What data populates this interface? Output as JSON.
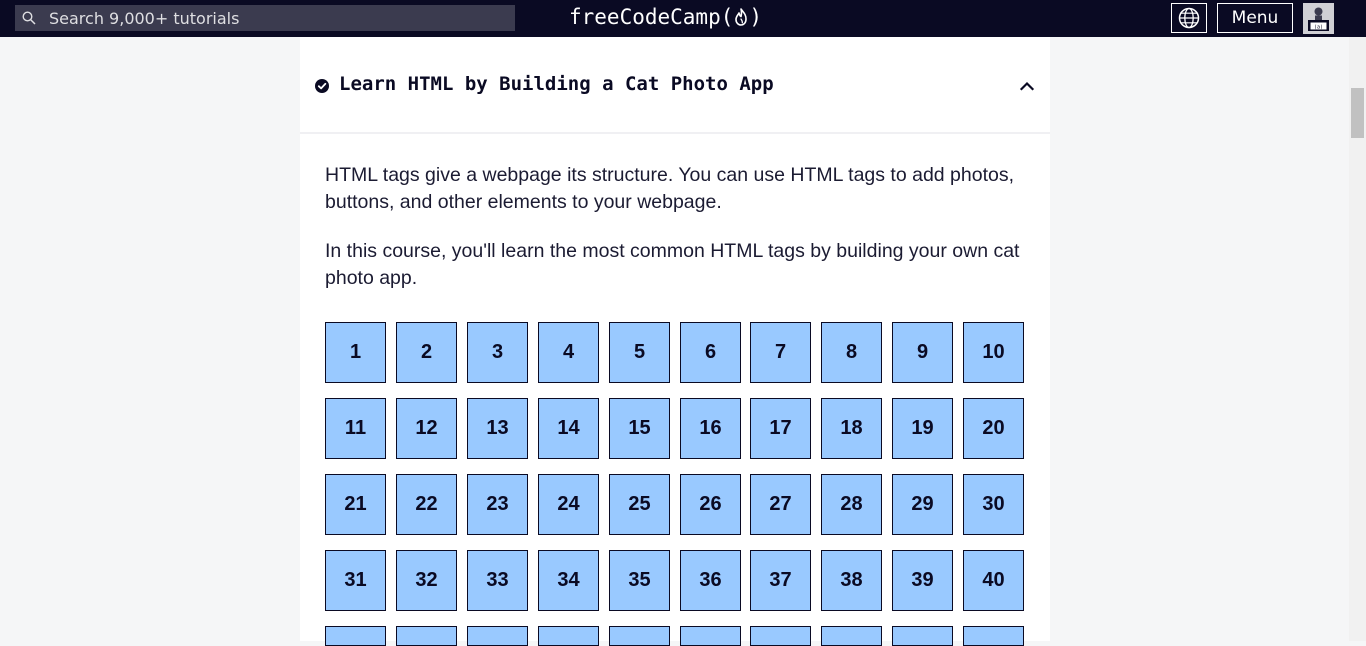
{
  "navbar": {
    "search_placeholder": "Search 9,000+ tutorials",
    "logo_prefix": "freeCodeCamp(",
    "logo_suffix": ")",
    "menu_label": "Menu",
    "background": "#0a0a23"
  },
  "block": {
    "title": "Learn HTML by Building a Cat Photo App",
    "completed": true,
    "expanded": true,
    "description": [
      "HTML tags give a webpage its structure. You can use HTML tags to add photos, buttons, and other elements to your webpage.",
      "In this course, you'll learn the most common HTML tags by building your own cat photo app."
    ],
    "step_color": "#99c9ff",
    "steps": [
      "1",
      "2",
      "3",
      "4",
      "5",
      "6",
      "7",
      "8",
      "9",
      "10",
      "11",
      "12",
      "13",
      "14",
      "15",
      "16",
      "17",
      "18",
      "19",
      "20",
      "21",
      "22",
      "23",
      "24",
      "25",
      "26",
      "27",
      "28",
      "29",
      "30",
      "31",
      "32",
      "33",
      "34",
      "35",
      "36",
      "37",
      "38",
      "39",
      "40"
    ]
  },
  "icons": {
    "search": "search-icon",
    "language": "globe-icon",
    "completed": "check-circle-icon",
    "collapse": "chevron-up-icon",
    "logo": "flame-icon",
    "avatar": "user-avatar"
  }
}
